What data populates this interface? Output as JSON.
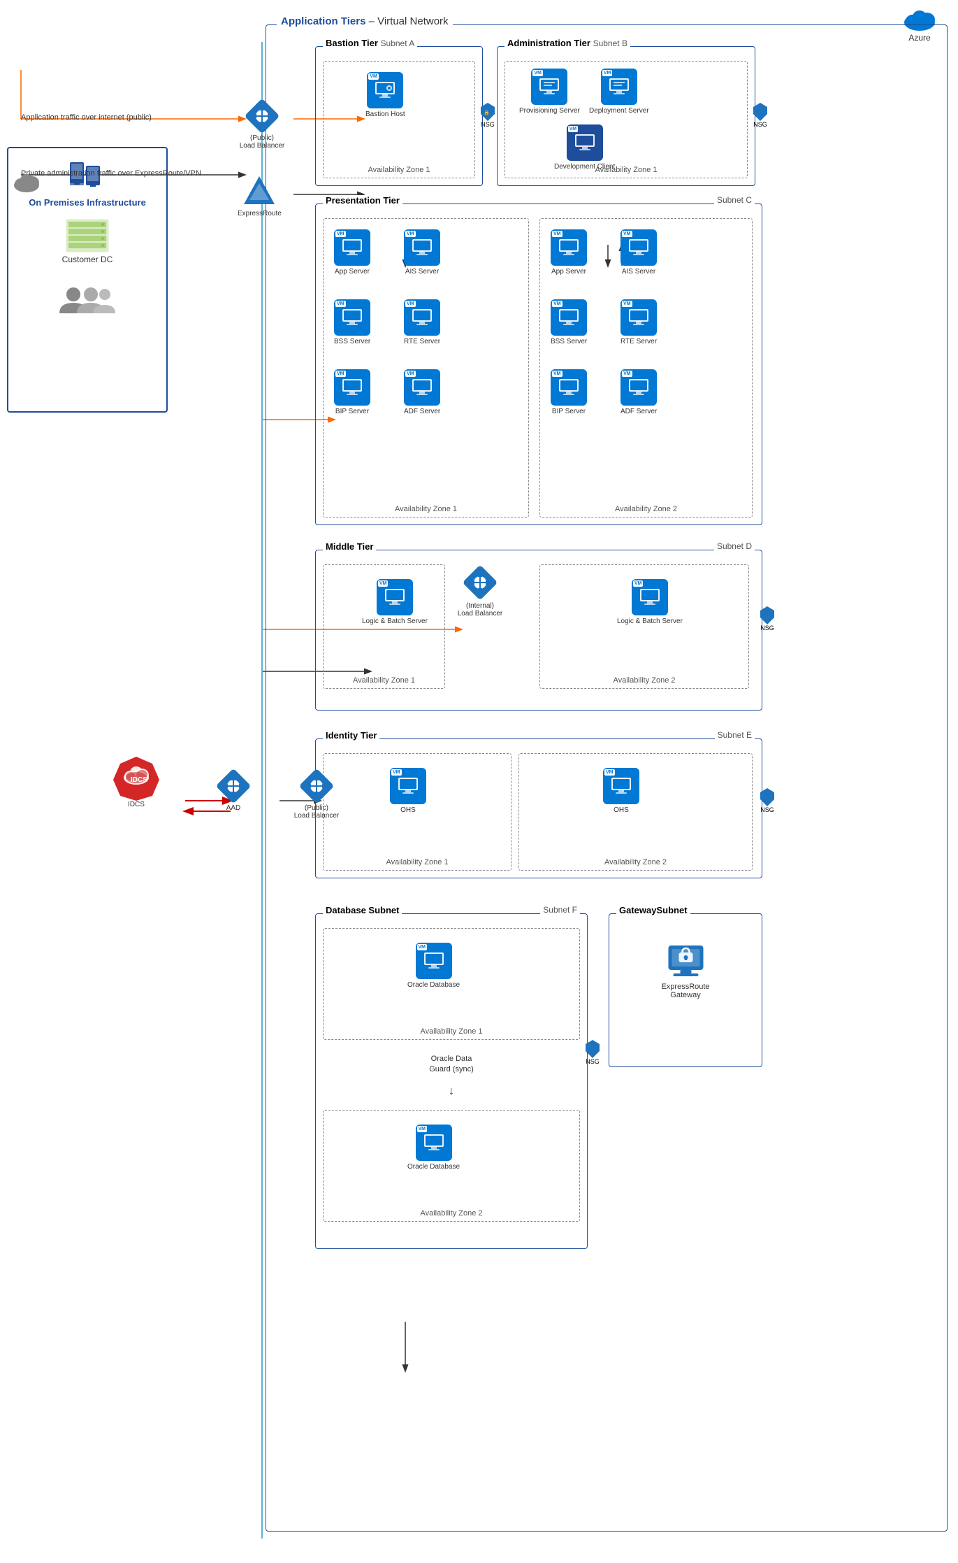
{
  "azure": {
    "label": "Azure"
  },
  "appTiers": {
    "title": "Application Tiers",
    "subtitle": "– Virtual Network"
  },
  "bastionTier": {
    "title": "Bastion Tier",
    "subnet": "Subnet A",
    "bastionHost": "Bastion Host",
    "az1": "Availability Zone 1"
  },
  "adminTier": {
    "title": "Administration Tier",
    "subnet": "Subnet B",
    "provisioningServer": "Provisioning Server",
    "deploymentServer": "Deployment Server",
    "developmentClient": "Development Client",
    "az1": "Availability Zone 1"
  },
  "presentationTier": {
    "title": "Presentation Tier",
    "subnet": "Subnet C",
    "az1": {
      "label": "Availability Zone 1",
      "servers": [
        "App Server",
        "AIS Server",
        "BSS Server",
        "RTE Server",
        "BIP Server",
        "ADF Server"
      ]
    },
    "az2": {
      "label": "Availability Zone 2",
      "servers": [
        "App Server",
        "AIS Server",
        "BSS Server",
        "RTE Server",
        "BIP Server",
        "ADF Server"
      ]
    }
  },
  "middleTier": {
    "title": "Middle Tier",
    "subnet": "Subnet D",
    "internalLB": "(Internal)\nLoad Balancer",
    "az1": {
      "label": "Availability Zone 1",
      "server": "Logic & Batch Server"
    },
    "az2": {
      "label": "Availability Zone 2",
      "server": "Logic & Batch Server"
    }
  },
  "identityTier": {
    "title": "Identity Tier",
    "subnet": "Subnet E",
    "az1": {
      "label": "Availability Zone 1",
      "server": "OHS"
    },
    "az2": {
      "label": "Availability Zone 2",
      "server": "OHS"
    },
    "publicLB": "(Public)\nLoad Balancer",
    "idcs": "IDCS",
    "aad": "AAD"
  },
  "databaseSubnet": {
    "title": "Database Subnet",
    "subnet": "Subnet F",
    "az1": {
      "label": "Availability Zone 1",
      "server": "Oracle Database"
    },
    "sync": "Oracle Data Guard (sync)",
    "az2": {
      "label": "Availability Zone 2",
      "server": "Oracle Database"
    }
  },
  "gatewaySubnet": {
    "title": "GatewaySubnet",
    "server": "ExpressRoute Gateway"
  },
  "onPremises": {
    "title": "On Premises Infrastructure",
    "customerDC": "Customer DC",
    "users": ""
  },
  "connections": {
    "internetTraffic": "Application traffic over internet (public)",
    "privateTraffic": "Private administration traffic over ExpressRoute/VPN",
    "publicLB": "(Public)\nLoad Balancer",
    "expressRoute": "ExpressRoute"
  },
  "nsg": "NSG",
  "vm": "VM"
}
